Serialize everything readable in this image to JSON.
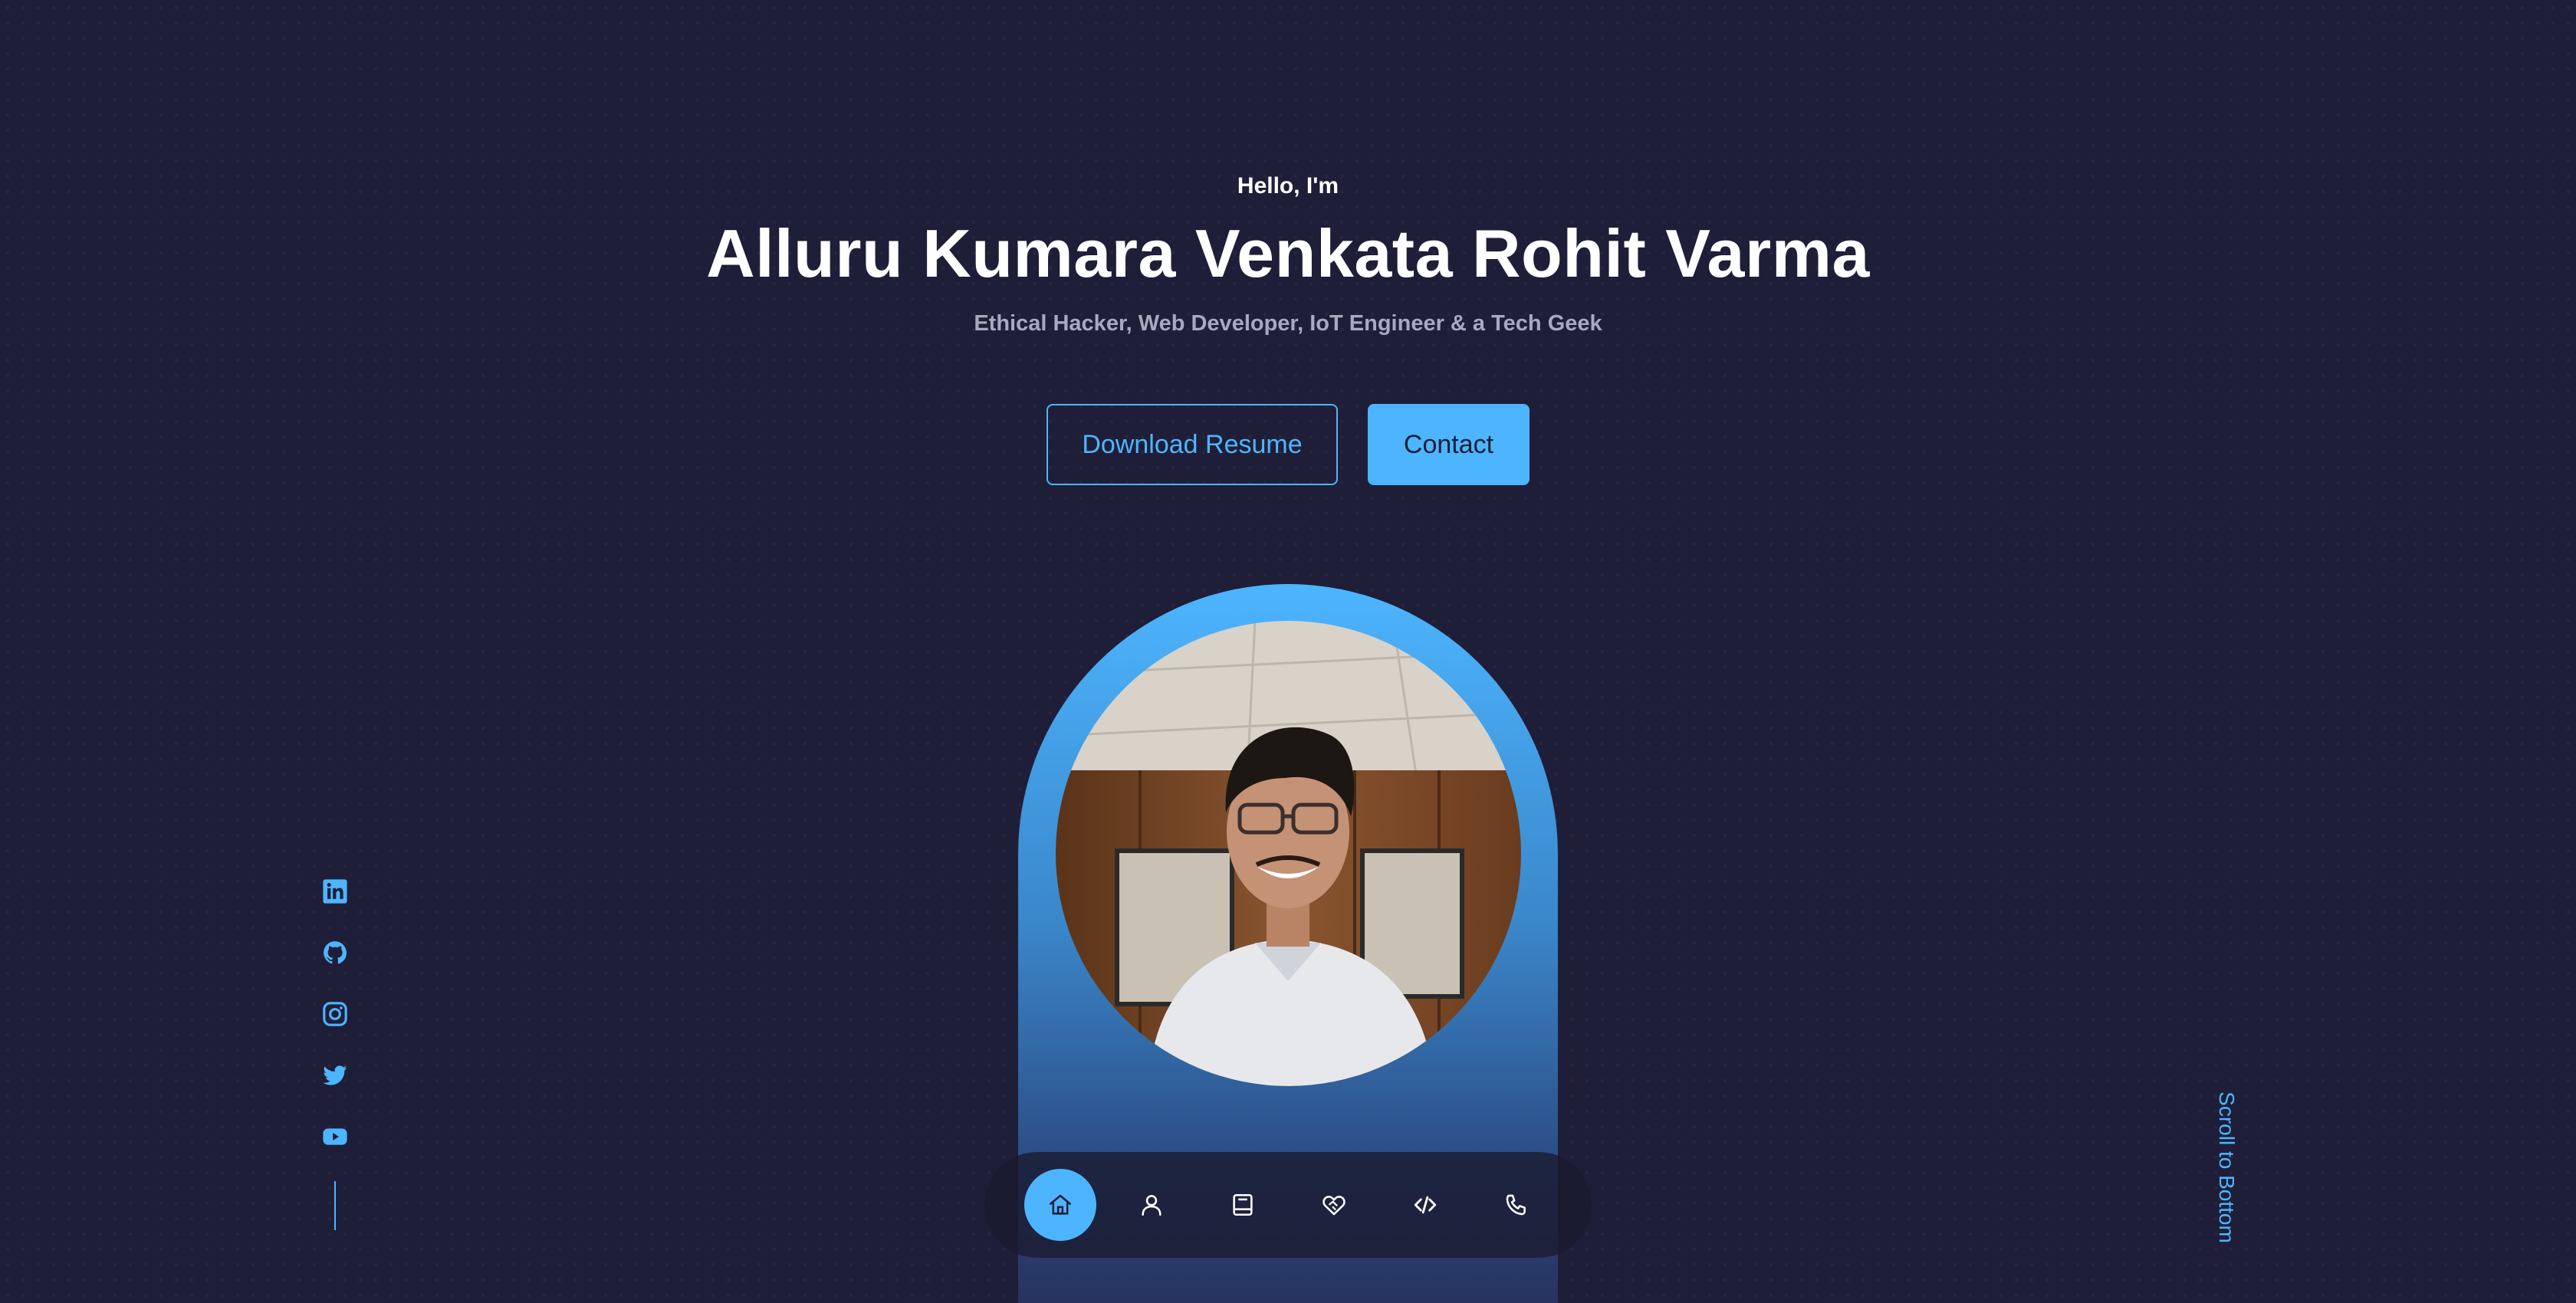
{
  "hero": {
    "greeting": "Hello, I'm",
    "name": "Alluru Kumara Venkata Rohit Varma",
    "tagline": "Ethical Hacker, Web Developer, IoT Engineer & a Tech Geek"
  },
  "buttons": {
    "resume_label": "Download Resume",
    "contact_label": "Contact"
  },
  "profile": {
    "image_icon": "profile-photo"
  },
  "socials": [
    {
      "icon": "linkedin-icon"
    },
    {
      "icon": "github-icon"
    },
    {
      "icon": "instagram-icon"
    },
    {
      "icon": "twitter-icon"
    },
    {
      "icon": "youtube-icon"
    }
  ],
  "scroll": {
    "label": "Scroll to Bottom"
  },
  "nav": {
    "items": [
      {
        "icon": "home-icon",
        "active": true
      },
      {
        "icon": "user-icon",
        "active": false
      },
      {
        "icon": "book-icon",
        "active": false
      },
      {
        "icon": "handshake-icon",
        "active": false
      },
      {
        "icon": "code-icon",
        "active": false
      },
      {
        "icon": "phone-icon",
        "active": false
      }
    ]
  },
  "colors": {
    "background": "#1f1e38",
    "accent": "#4db5ff",
    "text": "#ffffff",
    "muted": "#a9a8bd"
  }
}
